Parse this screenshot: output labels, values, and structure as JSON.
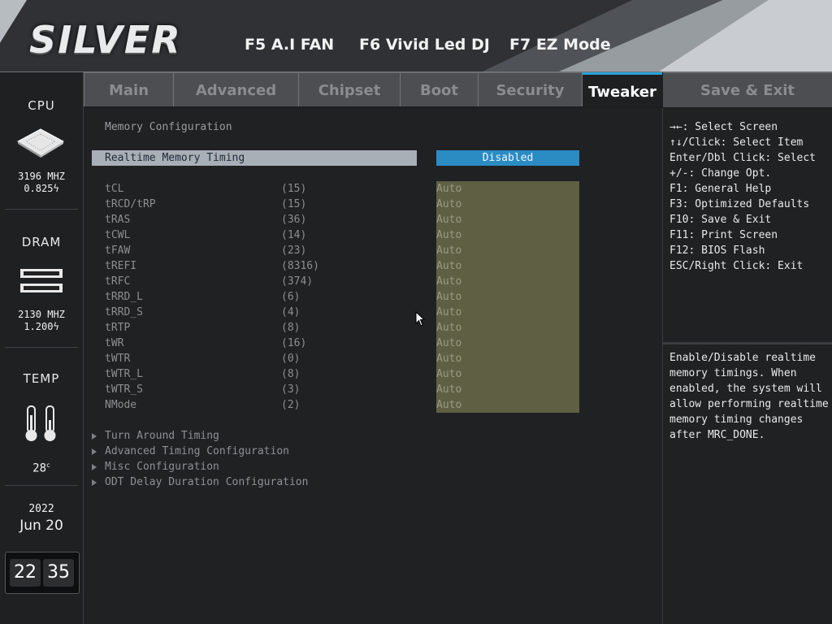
{
  "header": {
    "logo": "SILVER",
    "fkeys": [
      "F5 A.I FAN",
      "F6 Vivid Led DJ",
      "F7 EZ Mode"
    ]
  },
  "sidebar": {
    "cpu": {
      "title": "CPU",
      "freq": "3196 MHZ",
      "volt": "0.825"
    },
    "dram": {
      "title": "DRAM",
      "freq": "2130 MHZ",
      "volt": "1.200"
    },
    "temp": {
      "title": "TEMP",
      "value": "28"
    },
    "date": {
      "year": "2022",
      "month_day": "Jun 20"
    },
    "time": {
      "hours": "22",
      "minutes": "35"
    }
  },
  "tabs": [
    "Main",
    "Advanced",
    "Chipset",
    "Boot",
    "Security",
    "Tweaker",
    "Save & Exit"
  ],
  "active_tab": "Tweaker",
  "main": {
    "section_title": "Memory Configuration",
    "realtime": {
      "label": "Realtime Memory Timing",
      "value": "Disabled"
    },
    "timings": [
      {
        "name": "tCL",
        "value": "(15)",
        "setting": "Auto"
      },
      {
        "name": "tRCD/tRP",
        "value": "(15)",
        "setting": "Auto"
      },
      {
        "name": "tRAS",
        "value": "(36)",
        "setting": "Auto"
      },
      {
        "name": "tCWL",
        "value": "(14)",
        "setting": "Auto"
      },
      {
        "name": "tFAW",
        "value": "(23)",
        "setting": "Auto"
      },
      {
        "name": "tREFI",
        "value": "(8316)",
        "setting": "Auto"
      },
      {
        "name": "tRFC",
        "value": "(374)",
        "setting": "Auto"
      },
      {
        "name": "tRRD_L",
        "value": "(6)",
        "setting": "Auto"
      },
      {
        "name": "tRRD_S",
        "value": "(4)",
        "setting": "Auto"
      },
      {
        "name": "tRTP",
        "value": "(8)",
        "setting": "Auto"
      },
      {
        "name": "tWR",
        "value": "(16)",
        "setting": "Auto"
      },
      {
        "name": "tWTR",
        "value": "(0)",
        "setting": "Auto"
      },
      {
        "name": "tWTR_L",
        "value": "(8)",
        "setting": "Auto"
      },
      {
        "name": "tWTR_S",
        "value": "(3)",
        "setting": "Auto"
      },
      {
        "name": "NMode",
        "value": "(2)",
        "setting": "Auto"
      }
    ],
    "submenus": [
      "Turn Around Timing",
      "Advanced Timing Configuration",
      "Misc Configuration",
      "ODT Delay Duration Configuration"
    ]
  },
  "help": {
    "keys": [
      "→←: Select Screen",
      "↑↓/Click: Select Item",
      "Enter/Dbl Click: Select",
      "+/-: Change Opt.",
      "F1: General Help",
      "F3: Optimized Defaults",
      "F10: Save & Exit",
      "F11: Print Screen",
      "F12: BIOS Flash",
      "ESC/Right Click: Exit"
    ],
    "description": "Enable/Disable realtime memory timings. When enabled, the system will allow performing realtime memory timing changes after MRC_DONE."
  }
}
